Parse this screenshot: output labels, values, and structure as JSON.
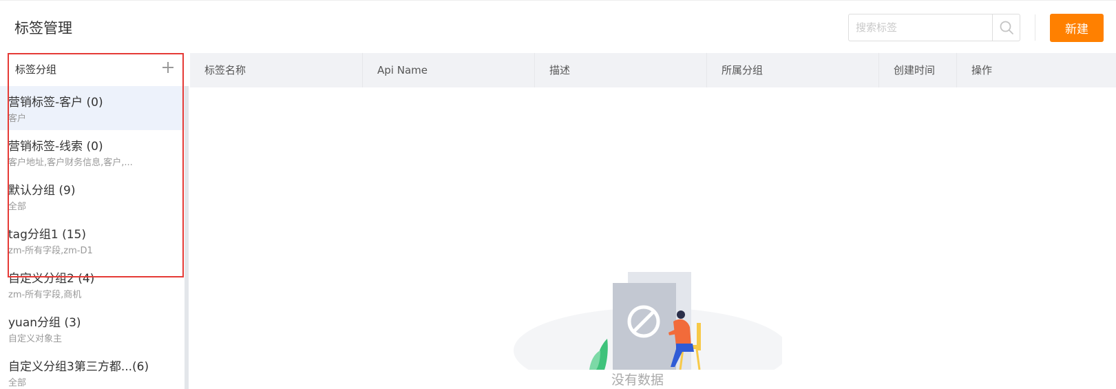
{
  "header": {
    "title": "标签管理",
    "search_placeholder": "搜索标签",
    "new_button_label": "新建"
  },
  "sidebar": {
    "title": "标签分组",
    "groups": [
      {
        "name": "营销标签-客户 (0)",
        "desc": "客户",
        "active": true
      },
      {
        "name": "营销标签-线索 (0)",
        "desc": "客户地址,客户财务信息,客户,...",
        "active": false
      },
      {
        "name": "默认分组 (9)",
        "desc": "全部",
        "active": false
      },
      {
        "name": "tag分组1 (15)",
        "desc": "zm-所有字段,zm-D1",
        "active": false
      },
      {
        "name": "自定义分组2 (4)",
        "desc": "zm-所有字段,商机",
        "active": false
      },
      {
        "name": "yuan分组 (3)",
        "desc": "自定义对象主",
        "active": false
      },
      {
        "name": "自定义分组3第三方都...(6)",
        "desc": "全部",
        "active": false
      }
    ]
  },
  "table": {
    "columns": [
      "标签名称",
      "Api Name",
      "描述",
      "所属分组",
      "创建时间",
      "操作"
    ],
    "empty_text": "没有数据"
  },
  "colors": {
    "accent": "#ff8000",
    "highlight": "#e53935",
    "active_group_bg": "#edf2fb"
  }
}
